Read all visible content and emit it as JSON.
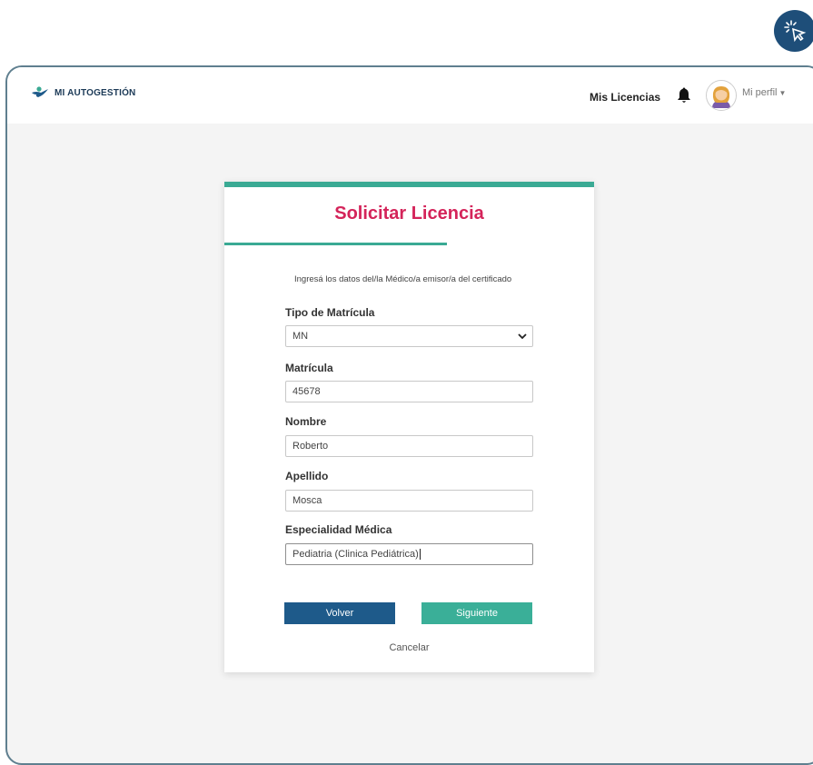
{
  "header": {
    "brand_name": "MI AUTOGESTIÓN",
    "nav_licencias": "Mis Licencias",
    "profile_label": "Mi perfil",
    "notification_icon": "bell-icon",
    "accent_color": "#3aaa94"
  },
  "form": {
    "title": "Solicitar Licencia",
    "intro": "Ingresá los datos del/la Médico/a emisor/a del certificado",
    "tipo_label": "Tipo de Matrícula",
    "tipo_value": "MN",
    "matricula_label": "Matrícula",
    "matricula_value": "45678",
    "nombre_label": "Nombre",
    "nombre_value": "Roberto",
    "apellido_label": "Apellido",
    "apellido_value": "Mosca",
    "especialidad_label": "Especialidad Médica",
    "especialidad_value": "Pediatria (Clinica Pediátrica)",
    "volver_label": "Volver",
    "siguiente_label": "Siguiente",
    "cancelar_label": "Cancelar",
    "title_color": "#d4245a",
    "volver_color": "#1e5a8a",
    "siguiente_color": "#3aaf98"
  }
}
